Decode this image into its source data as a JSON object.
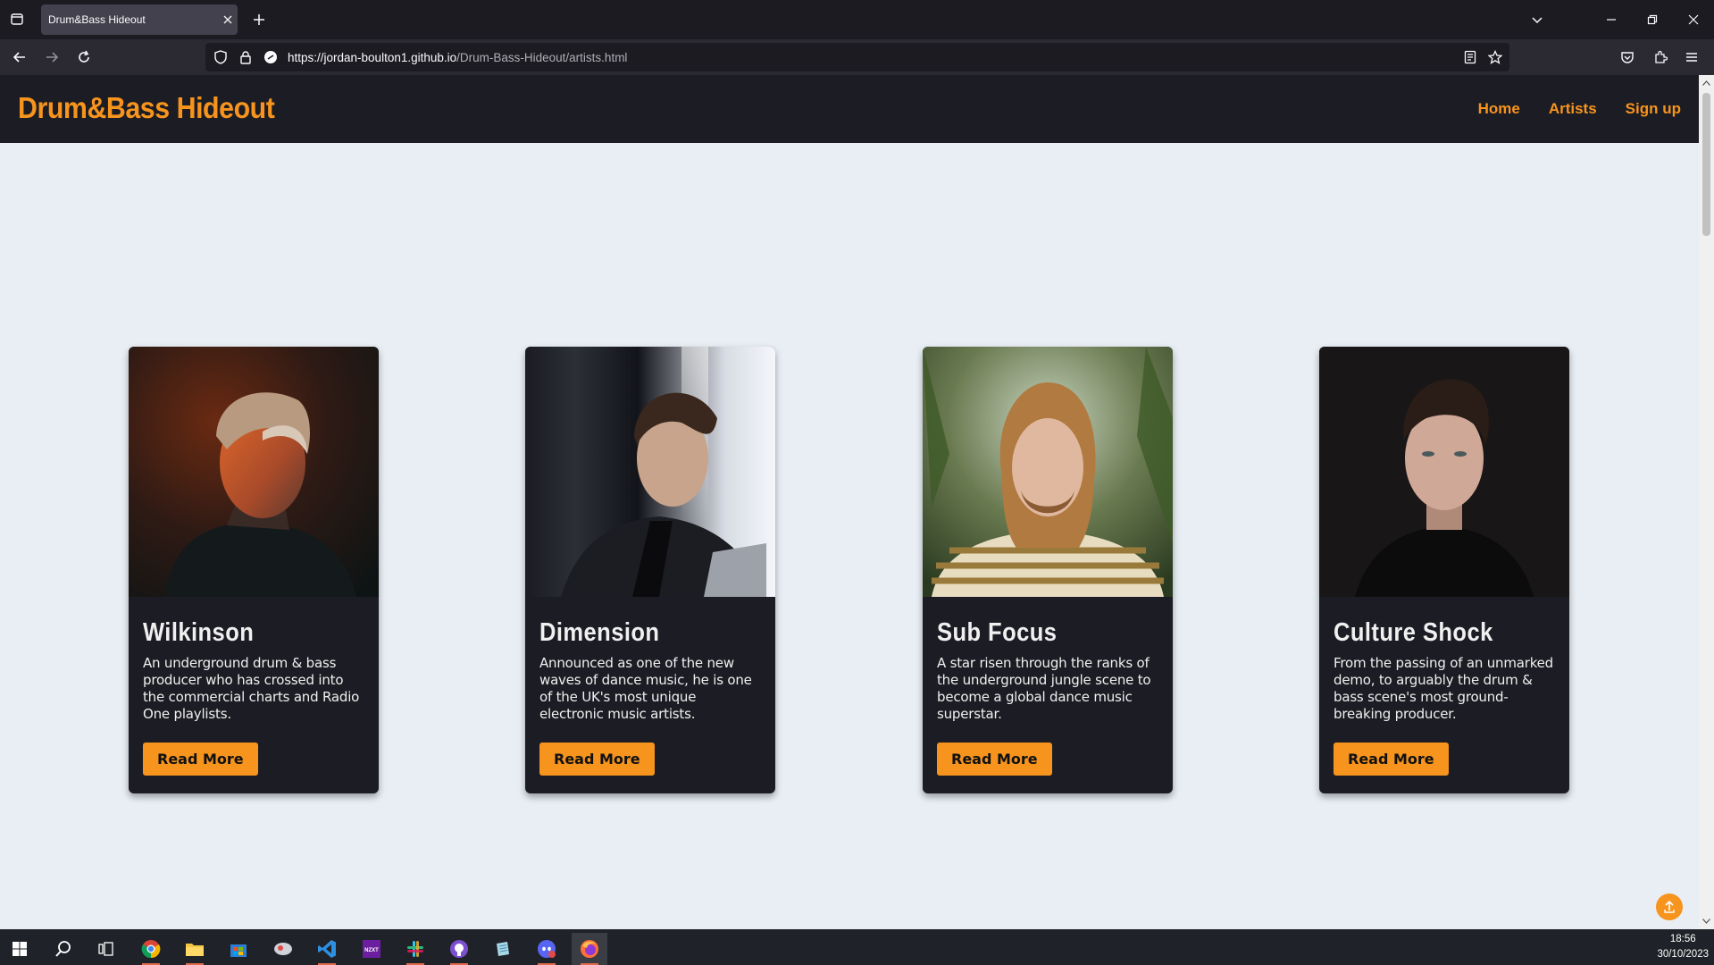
{
  "browser": {
    "tab_title": "Drum&Bass Hideout",
    "url_host": "https://jordan-boulton1.github.io",
    "url_path": "/Drum-Bass-Hideout/artists.html"
  },
  "site": {
    "logo": "Drum&Bass Hideout",
    "nav": [
      {
        "label": "Home"
      },
      {
        "label": "Artists"
      },
      {
        "label": "Sign up"
      }
    ],
    "accent_color": "#f7941d",
    "card_bg_color": "#1c1c24",
    "page_bg_color": "#e8eef4"
  },
  "artists": [
    {
      "name": "Wilkinson",
      "description": "An underground drum & bass producer who has crossed into the commercial charts and Radio One playlists.",
      "button": "Read More"
    },
    {
      "name": "Dimension",
      "description": "Announced as one of the new waves of dance music, he is one of the UK's most unique electronic music artists.",
      "button": "Read More"
    },
    {
      "name": "Sub Focus",
      "description": "A star risen through the ranks of the underground jungle scene to become a global dance music superstar.",
      "button": "Read More"
    },
    {
      "name": "Culture Shock",
      "description": "From the passing of an unmarked demo, to arguably the drum & bass scene's most ground-breaking producer.",
      "button": "Read More"
    }
  ],
  "taskbar": {
    "time": "18:56",
    "date": "30/10/2023",
    "apps": [
      "start-icon",
      "search-icon",
      "task-view-icon",
      "chrome-icon",
      "file-explorer-icon",
      "store-icon",
      "app-icon",
      "vscode-icon",
      "nzxt-icon",
      "slack-icon",
      "github-icon",
      "notes-icon",
      "discord-icon",
      "firefox-icon"
    ]
  }
}
